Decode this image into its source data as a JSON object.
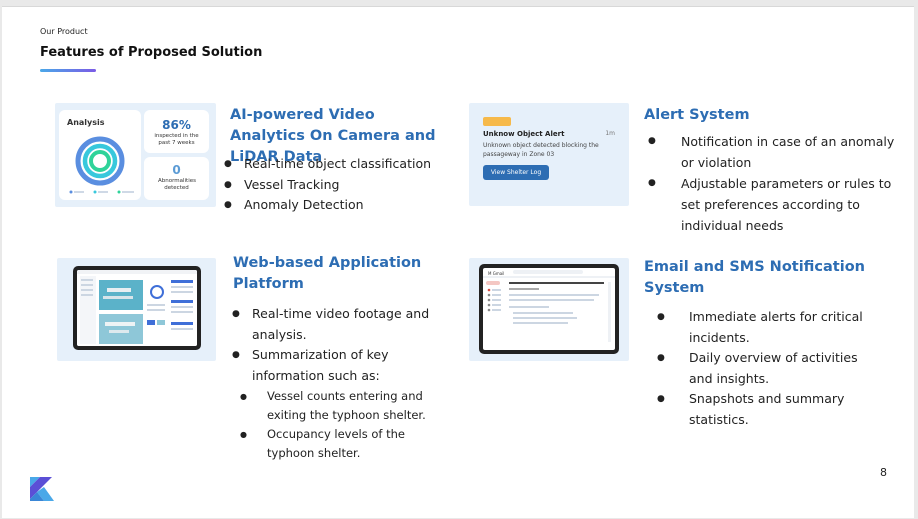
{
  "header": {
    "eyebrow": "Our Product",
    "title": "Features of Proposed Solution"
  },
  "features": {
    "analytics": {
      "heading": "AI-powered Video Analytics On Camera and LiDAR Data",
      "bullets": [
        "Real-time object classification",
        "Vessel Tracking",
        "Anomaly Detection"
      ],
      "card": {
        "title": "Analysis",
        "stat1_value": "86%",
        "stat1_caption": "inspected in the past 7 weeks",
        "stat2_value": "0",
        "stat2_caption": "Abnormalities detected"
      }
    },
    "alert": {
      "heading": "Alert System",
      "bullets": [
        "Notification in case of an anomaly or violation",
        "Adjustable parameters or rules to set preferences according to individual needs"
      ],
      "card": {
        "title": "Unknow Object Alert",
        "time": "1m",
        "body": "Unknown object detected blocking the passageway in Zone 03",
        "button": "View Shelter Log"
      }
    },
    "web": {
      "heading": "Web-based Application Platform",
      "bullets": [
        "Real-time video footage and analysis.",
        "Summarization of key information such as:"
      ],
      "sub_bullets": [
        "Vessel counts entering and exiting the typhoon shelter.",
        "Occupancy levels of the typhoon shelter."
      ]
    },
    "email": {
      "heading": "Email and SMS Notification System",
      "bullets": [
        "Immediate alerts for critical incidents.",
        "Daily overview of activities and insights.",
        "Snapshots and summary statistics."
      ],
      "card": {
        "app_label": "M Gmail"
      }
    }
  },
  "footer": {
    "page_number": "8"
  },
  "colors": {
    "accent": "#2d6db3",
    "card_bg": "#e6f0fa",
    "logo_light": "#4aa8e8",
    "logo_dark": "#5b4fd6"
  }
}
